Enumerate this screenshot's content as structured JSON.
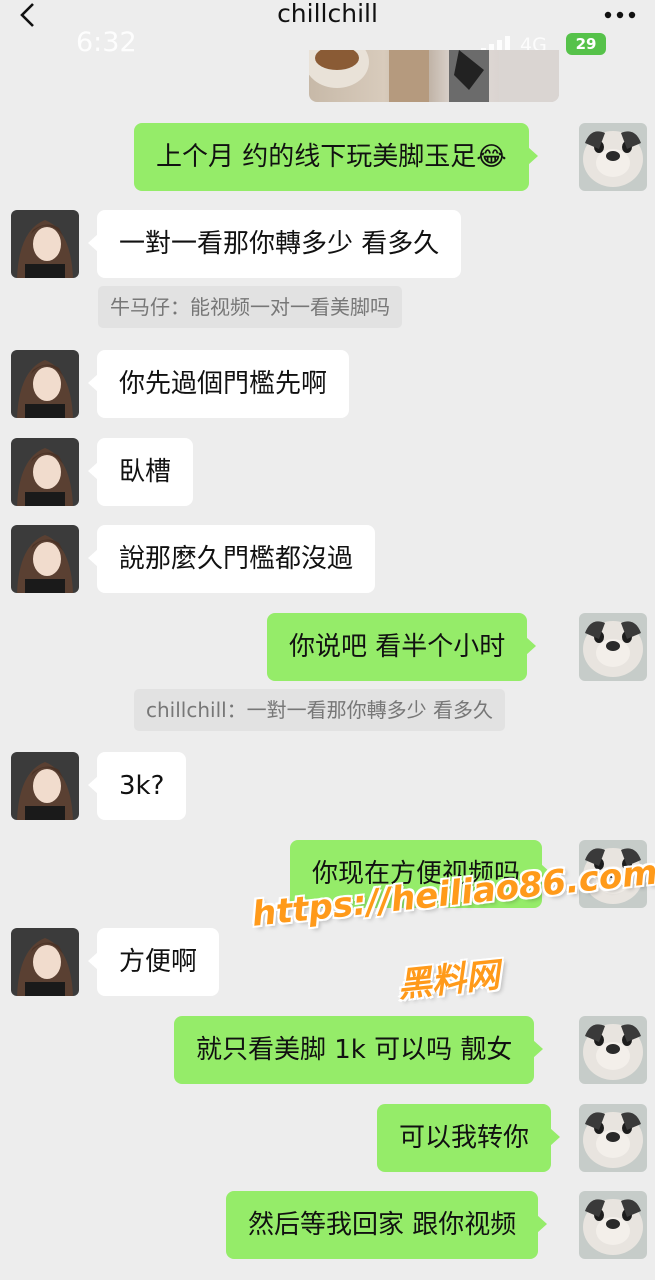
{
  "header": {
    "title": "chillchill",
    "back_icon": "chevron-left-icon",
    "more_icon": "more-dots-icon"
  },
  "status_bar": {
    "time": "6:32",
    "network": "4G",
    "battery": "29"
  },
  "colors": {
    "background": "#ededed",
    "outgoing_bubble": "#95ec69",
    "incoming_bubble": "#ffffff",
    "quote_bg": "#e2e2e2"
  },
  "messages": [
    {
      "side": "out",
      "text": "上个月 约的线下玩美脚玉足😂"
    },
    {
      "side": "in",
      "text": "一對一看那你轉多少 看多久",
      "quote": "牛马仔：能视频一对一看美脚吗"
    },
    {
      "side": "in",
      "text": "你先過個門檻先啊"
    },
    {
      "side": "in",
      "text": "臥槽"
    },
    {
      "side": "in",
      "text": "說那麼久門檻都沒過"
    },
    {
      "side": "out",
      "text": "你说吧  看半个小时",
      "quote": "chillchill：一對一看那你轉多少 看多久"
    },
    {
      "side": "in",
      "text": "3k?"
    },
    {
      "side": "out",
      "text": "你现在方便视频吗"
    },
    {
      "side": "in",
      "text": "方便啊"
    },
    {
      "side": "out",
      "text": "就只看美脚  1k 可以吗  靓女"
    },
    {
      "side": "out",
      "text": "可以我转你"
    },
    {
      "side": "out",
      "text": "然后等我回家  跟你视频"
    }
  ],
  "watermark": {
    "url": "https://heiliao86.com",
    "name": "黑料网"
  }
}
